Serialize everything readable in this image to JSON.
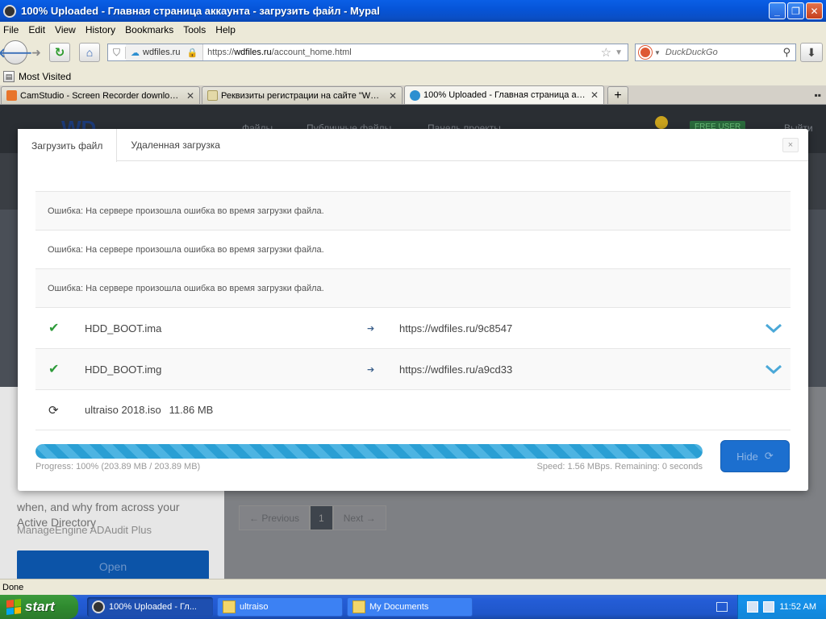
{
  "window": {
    "title": "100% Uploaded - Главная страница аккаунта - загрузить файл - Mypal",
    "buttons": [
      "_",
      "❐",
      "✕"
    ]
  },
  "menu": [
    "File",
    "Edit",
    "View",
    "History",
    "Bookmarks",
    "Tools",
    "Help"
  ],
  "nav": {
    "site_identity": "wdfiles.ru",
    "url_prefix": "https://",
    "url_host": "wdfiles.ru",
    "url_path": "/account_home.html",
    "search_placeholder": "DuckDuckGo"
  },
  "bookmarks": {
    "most_visited": "Most Visited"
  },
  "tabs": [
    {
      "label": "CamStudio - Screen Recorder download |...",
      "active": false,
      "icon_color": "#e8742a"
    },
    {
      "label": "Реквизиты регистрации на сайте \"WD...",
      "active": false,
      "icon_color": "#e3d9a8"
    },
    {
      "label": "100% Uploaded - Главная страница ак...",
      "active": true,
      "icon_color": "#2d8fd0"
    }
  ],
  "background": {
    "logo": "WD",
    "nav_items": [
      "Файлы",
      "Публичные файлы",
      "Панель проекты"
    ],
    "free_user": "FREE USER",
    "logout": "Выйти",
    "left_text": "when, and why from across your Active Directory",
    "left_sub": "ManageEngine ADAudit Plus",
    "open_button": "Open",
    "pager_prev": "← Previous",
    "pager_current": "1",
    "pager_next": "Next →"
  },
  "modal": {
    "tabs": [
      "Загрузить файл",
      "Удаленная загрузка"
    ],
    "close": "×",
    "errors": [
      "Ошибка: На сервере произошла ошибка во время загрузки файла.",
      "Ошибка: На сервере произошла ошибка во время загрузки файла.",
      "Ошибка: На сервере произошла ошибка во время загрузки файла."
    ],
    "files": [
      {
        "name": "HDD_BOOT.ima",
        "link": "https://wdfiles.ru/9c8547",
        "status": "done"
      },
      {
        "name": "HDD_BOOT.img",
        "link": "https://wdfiles.ru/a9cd33",
        "status": "done"
      },
      {
        "name": "ultraiso 2018.iso",
        "size": "11.86 MB",
        "status": "processing"
      }
    ],
    "progress": {
      "percent": 100,
      "label": "Progress: 100% (203.89 MB / 203.89 MB)",
      "speed": "Speed: 1.56 MBps. Remaining: 0 seconds"
    },
    "hide_button": "Hide"
  },
  "status_bar": "Done",
  "taskbar": {
    "start": "start",
    "tasks": [
      {
        "label": "100% Uploaded - Гл...",
        "active": true
      },
      {
        "label": "ultraiso",
        "active": false
      },
      {
        "label": "My Documents",
        "active": false
      }
    ],
    "clock": "11:52 AM"
  },
  "colors": {
    "accent": "#1c6fcf",
    "progress": "#2a9fd4",
    "success": "#2e9b3a",
    "xp_blue": "#245dd7"
  }
}
